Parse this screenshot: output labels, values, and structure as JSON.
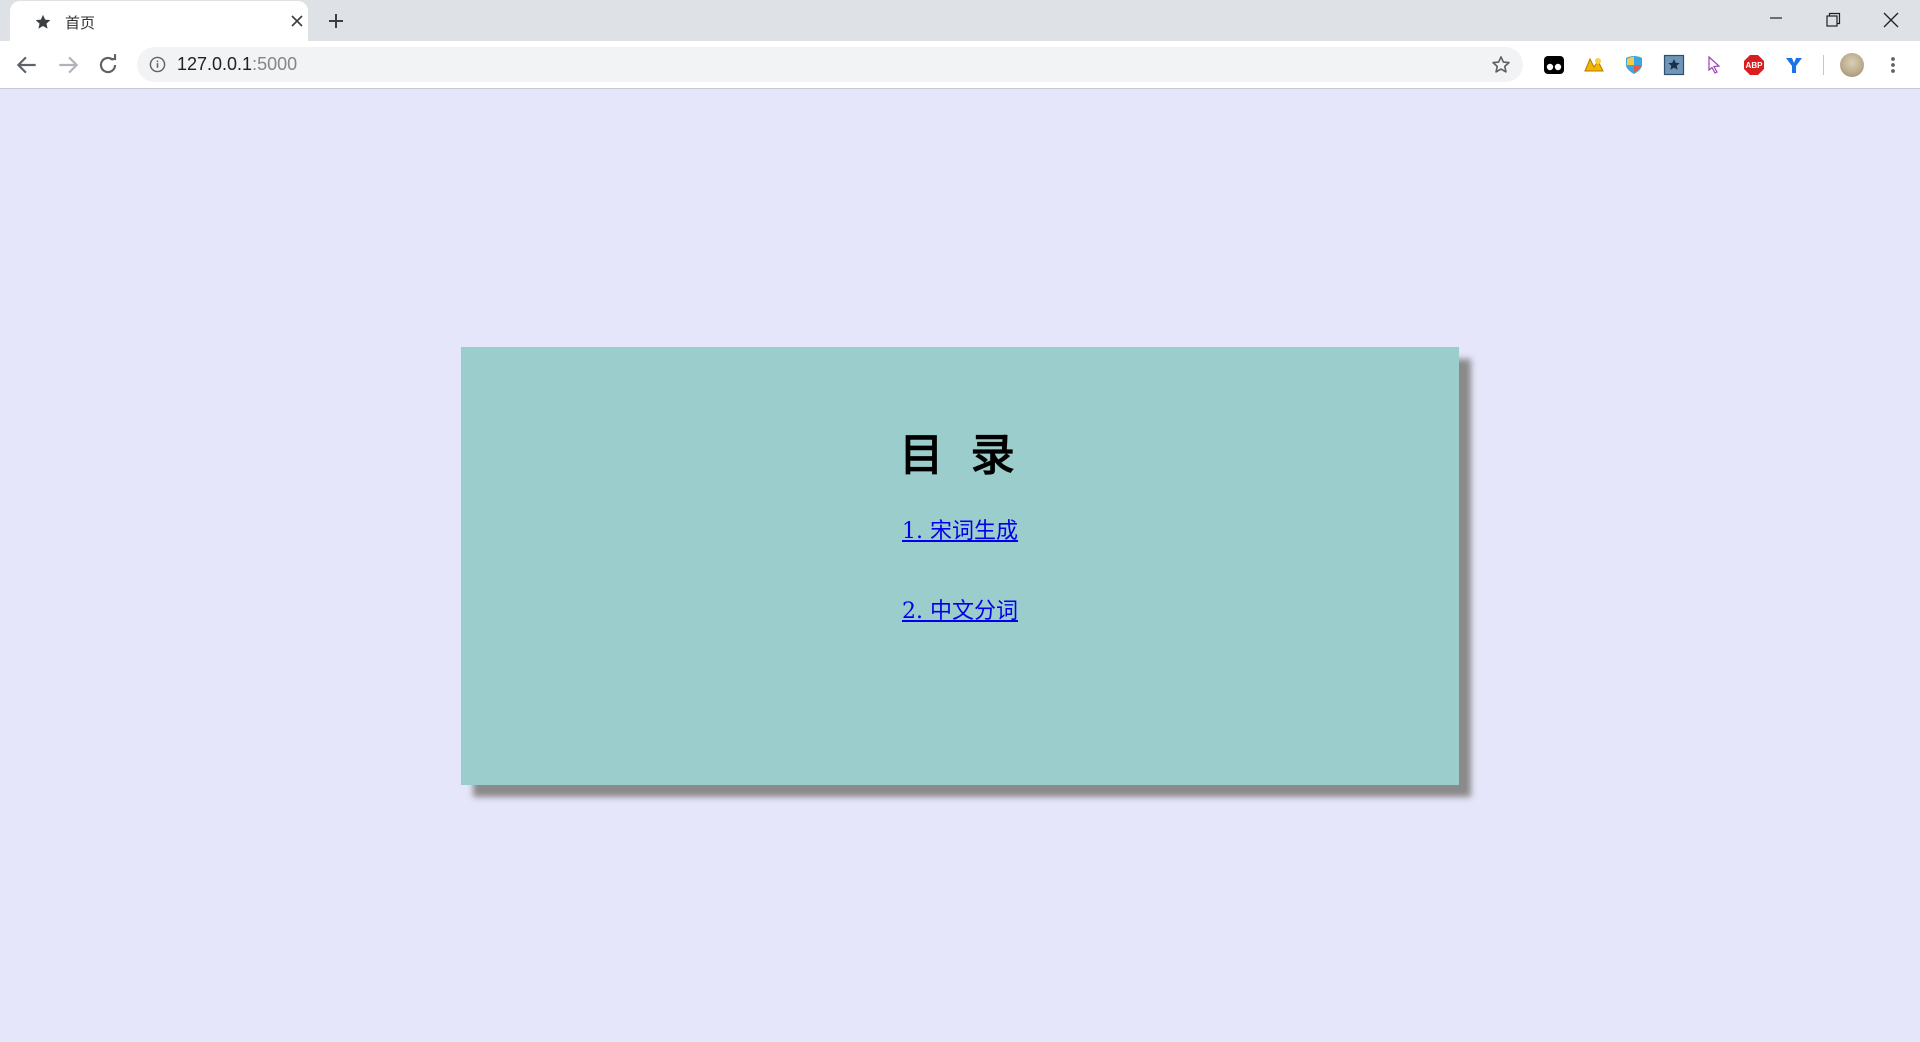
{
  "browser": {
    "tab": {
      "title": "首页",
      "favicon": "star-icon"
    },
    "omnibox": {
      "url_host": "127.0.0.1",
      "url_port": ":5000",
      "info_icon": "info-icon",
      "bookmark_icon": "bookmark-star-icon"
    },
    "extensions": [
      "tampermonkey-icon",
      "extension-yellow-icon",
      "extension-shield-icon",
      "extension-star-icon",
      "extension-cursor-icon",
      "adblock-plus-icon",
      "extension-y-icon"
    ],
    "adblock_label": "ABP"
  },
  "page": {
    "background": "#e6e6fa",
    "card_background": "#9ccdcd",
    "title": "目 录",
    "links": [
      {
        "label": "1. 宋词生成"
      },
      {
        "label": "2. 中文分词"
      }
    ],
    "link_color": "#0000ee"
  }
}
